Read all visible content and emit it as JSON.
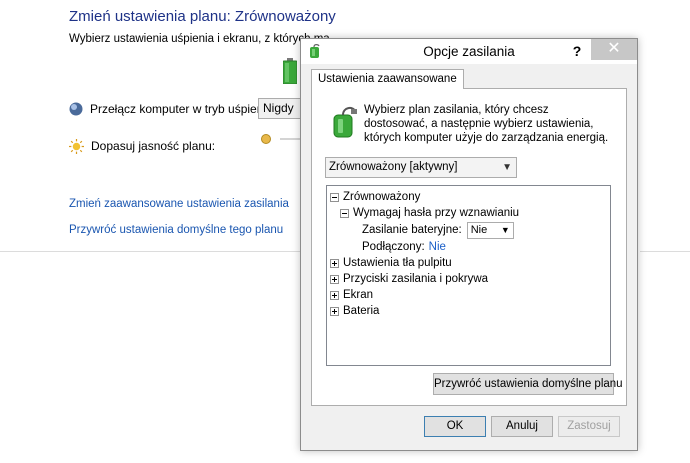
{
  "background": {
    "title": "Zmień ustawienia planu: Zrównoważony",
    "subtitle": "Wybierz ustawienia uśpienia i ekranu, z których ma",
    "sleep_label": "Przełącz komputer w tryb uśpienia:",
    "sleep_value": "Nigdy",
    "brightness_label": "Dopasuj jasność planu:",
    "link_advanced": "Zmień zaawansowane ustawienia zasilania",
    "link_restore": "Przywróć ustawienia domyślne tego planu"
  },
  "dialog": {
    "title": "Opcje zasilania",
    "help": "?",
    "close": "✕",
    "tab": "Ustawienia zaawansowane",
    "description": "Wybierz plan zasilania, który chcesz dostosować, a następnie wybierz ustawienia, których komputer użyje do zarządzania energią.",
    "plan_select": "Zrównoważony [aktywny]",
    "tree": {
      "root": "Zrównoważony",
      "child": "Wymagaj hasła przy wznawianiu",
      "battery_label": "Zasilanie bateryjne:",
      "battery_value": "Nie",
      "plugged_label": "Podłączony:",
      "plugged_value": "Nie",
      "items": [
        "Ustawienia tła pulpitu",
        "Przyciski zasilania i pokrywa",
        "Ekran",
        "Bateria"
      ]
    },
    "restore_button": "Przywróć ustawienia domyślne planu",
    "ok": "OK",
    "cancel": "Anuluj",
    "apply": "Zastosuj"
  },
  "colors": {
    "title_blue": "#1e3287",
    "link_blue": "#1a56b0",
    "value_blue": "#1a5fc8",
    "close_bg": "#c7c7c7",
    "battery_green": "#3aa83a"
  }
}
